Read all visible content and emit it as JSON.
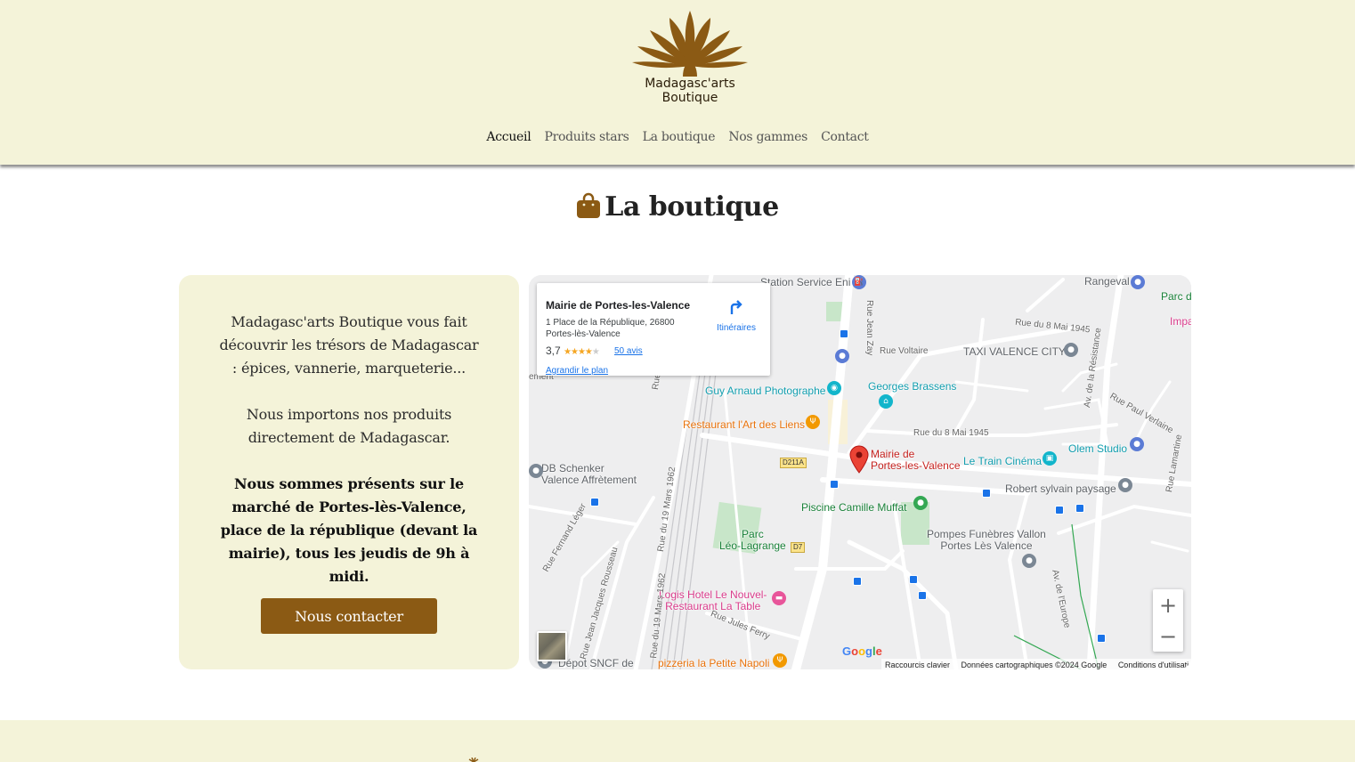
{
  "brand": {
    "name_line1": "Madagasc'arts",
    "name_line2": "Boutique",
    "color": "#8b5a14"
  },
  "nav": [
    {
      "label": "Accueil",
      "active": true
    },
    {
      "label": "Produits stars"
    },
    {
      "label": "La boutique"
    },
    {
      "label": "Nos gammes"
    },
    {
      "label": "Contact"
    }
  ],
  "page": {
    "title": "La boutique",
    "title_icon": "shopping-bag-icon"
  },
  "info": {
    "paragraph1": "Madagasc'arts Boutique vous fait découvrir les trésors de Madagascar : épices, vannerie, marqueterie...",
    "paragraph2": "Nous importons nos produits directement de Madagascar.",
    "paragraph3": "Nous sommes présents sur le marché de Portes-lès-Valence, place de la république (devant la mairie), tous les jeudis de 9h à midi.",
    "button_label": "Nous contacter"
  },
  "map": {
    "place": {
      "name": "Mairie de Portes-les-Valence",
      "address": "1 Place de la République, 26800 Portes-lès-Valence",
      "rating": "3,7",
      "stars": 3.7,
      "reviews": "50 avis",
      "directions": "Itinéraires",
      "enlarge": "Agrandir le plan"
    },
    "labels": {
      "station": "Station Service Eni",
      "rangeval": "Rangeval",
      "parc_top": "Parc d",
      "impa": "Impa",
      "taxi": "TAXI VALENCE CITY",
      "guy": "Guy Arnaud Photographe",
      "brassens": "Georges Brassens",
      "restaurant_art": "Restaurant l'Art des Liens",
      "olem": "Olem Studio",
      "mairie_line1": "Mairie de",
      "mairie_line2": "Portes-les-Valence",
      "train": "Le Train Cinéma",
      "db_line1": "DB Schenker",
      "db_line2": "Valence Affrètement",
      "robert": "Robert sylvain paysage",
      "piscine": "Piscine Camille Muffat",
      "parc_line1": "Parc",
      "parc_line2": "Léo-Lagrange",
      "pompes_line1": "Pompes Funèbres Vallon",
      "pompes_line2": "Portes Lès Valence",
      "logis_line1": "Logis Hotel Le Nouvel-",
      "logis_line2": "Restaurant La Table",
      "pizzeria": "pizzeria la Petite Napoli",
      "depot": "Dépot SNCF de",
      "ement": "ement",
      "rue_jean_zay": "Rue Jean Zay",
      "rue_8mai": "Rue du 8 Mai 1945",
      "rue_voltaire": "Rue Voltaire",
      "rue_8mai_2": "Rue du 8 Mai 1945",
      "av_resistance": "Av. de la Résistance",
      "rue_paul_verlaine": "Rue Paul Verlaine",
      "rue_lamartine": "Rue Lamartine",
      "rue_19mars": "Rue du 19 Mars 1962",
      "rue_19mars_2": "Rue du 19 Mars 1962",
      "rue_fernand": "Rue Fernand Léger",
      "rue_jean_jacques": "Rue Jean Jacques Rousseau",
      "rue_jules_ferry": "Rue Jules Ferry",
      "av_europe": "Av. de l'Europe",
      "d211a": "D211A",
      "d7": "D7",
      "rue_short": "Rue"
    },
    "google": "Google",
    "attribution": {
      "shortcuts": "Raccourcis clavier",
      "data": "Données cartographiques ©2024 Google",
      "terms": "Conditions d'utilisation"
    },
    "zoom_in": "+",
    "zoom_out": "−"
  }
}
